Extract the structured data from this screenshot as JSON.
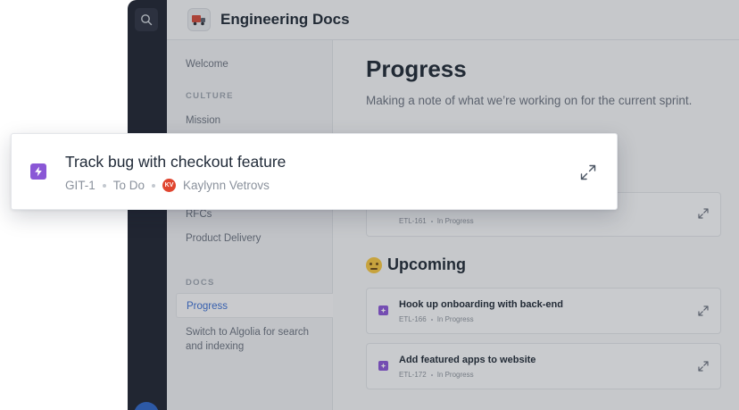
{
  "app": {
    "title": "Engineering Docs"
  },
  "sidebar": {
    "items": [
      {
        "label": "Welcome"
      },
      {
        "label": "Mission"
      },
      {
        "label": "RFCs"
      },
      {
        "label": "Product Delivery"
      },
      {
        "label": "Progress",
        "active": true
      },
      {
        "label": "Switch to Algolia for search and indexing"
      }
    ],
    "sections": {
      "culture": "CULTURE",
      "docs": "DOCS"
    }
  },
  "page": {
    "title": "Progress",
    "description": "Making a note of what we’re working on for the current sprint.",
    "upcoming_heading": "Upcoming"
  },
  "partial_card": {
    "key": "ETL-161",
    "status": "In Progress"
  },
  "upcoming": [
    {
      "title": "Hook up onboarding with back-end",
      "key": "ETL-166",
      "status": "In Progress"
    },
    {
      "title": "Add featured apps to website",
      "key": "ETL-172",
      "status": "In Progress"
    }
  ],
  "issue": {
    "title": "Track bug with checkout feature",
    "key": "GIT-1",
    "status": "To Do",
    "assignee": "Kaylynn Vetrovs",
    "assignee_initials": "KV"
  },
  "colors": {
    "accent": "#3b6ed1",
    "issue_icon": "#8a57d6",
    "rail": "#1f2433",
    "avatar": "#e0452f"
  },
  "icons": [
    "search-icon",
    "truck-logo-icon",
    "bolt-icon",
    "expand-icon",
    "thinking-emoji-icon"
  ]
}
